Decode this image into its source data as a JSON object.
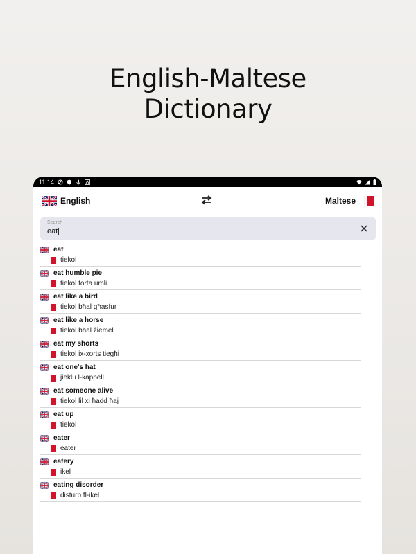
{
  "headline": {
    "line1": "English-Maltese",
    "line2": "Dictionary"
  },
  "statusbar": {
    "time": "11:14"
  },
  "langbar": {
    "source_label": "English",
    "target_label": "Maltese",
    "swap_icon": "swap-arrows-icon",
    "colors": {
      "malta_red": "#cf142b"
    }
  },
  "search": {
    "placeholder": "Search",
    "value": "eat",
    "clear_icon": "close-icon"
  },
  "results": [
    {
      "en": "eat",
      "mt": "tiekol"
    },
    {
      "en": "eat humble pie",
      "mt": "tiekol torta umli"
    },
    {
      "en": "eat like a bird",
      "mt": "tiekol bħal għasfur"
    },
    {
      "en": "eat like a horse",
      "mt": "tiekol bħal żiemel"
    },
    {
      "en": "eat my shorts",
      "mt": "tiekol ix-xorts tiegħi"
    },
    {
      "en": "eat one's hat",
      "mt": "jieklu l-kappell"
    },
    {
      "en": "eat someone alive",
      "mt": "tiekol lil xi ħadd ħaj"
    },
    {
      "en": "eat up",
      "mt": "tiekol"
    },
    {
      "en": "eater",
      "mt": "eater"
    },
    {
      "en": "eatery",
      "mt": "ikel"
    },
    {
      "en": "eating disorder",
      "mt": "disturb fl-ikel"
    }
  ]
}
